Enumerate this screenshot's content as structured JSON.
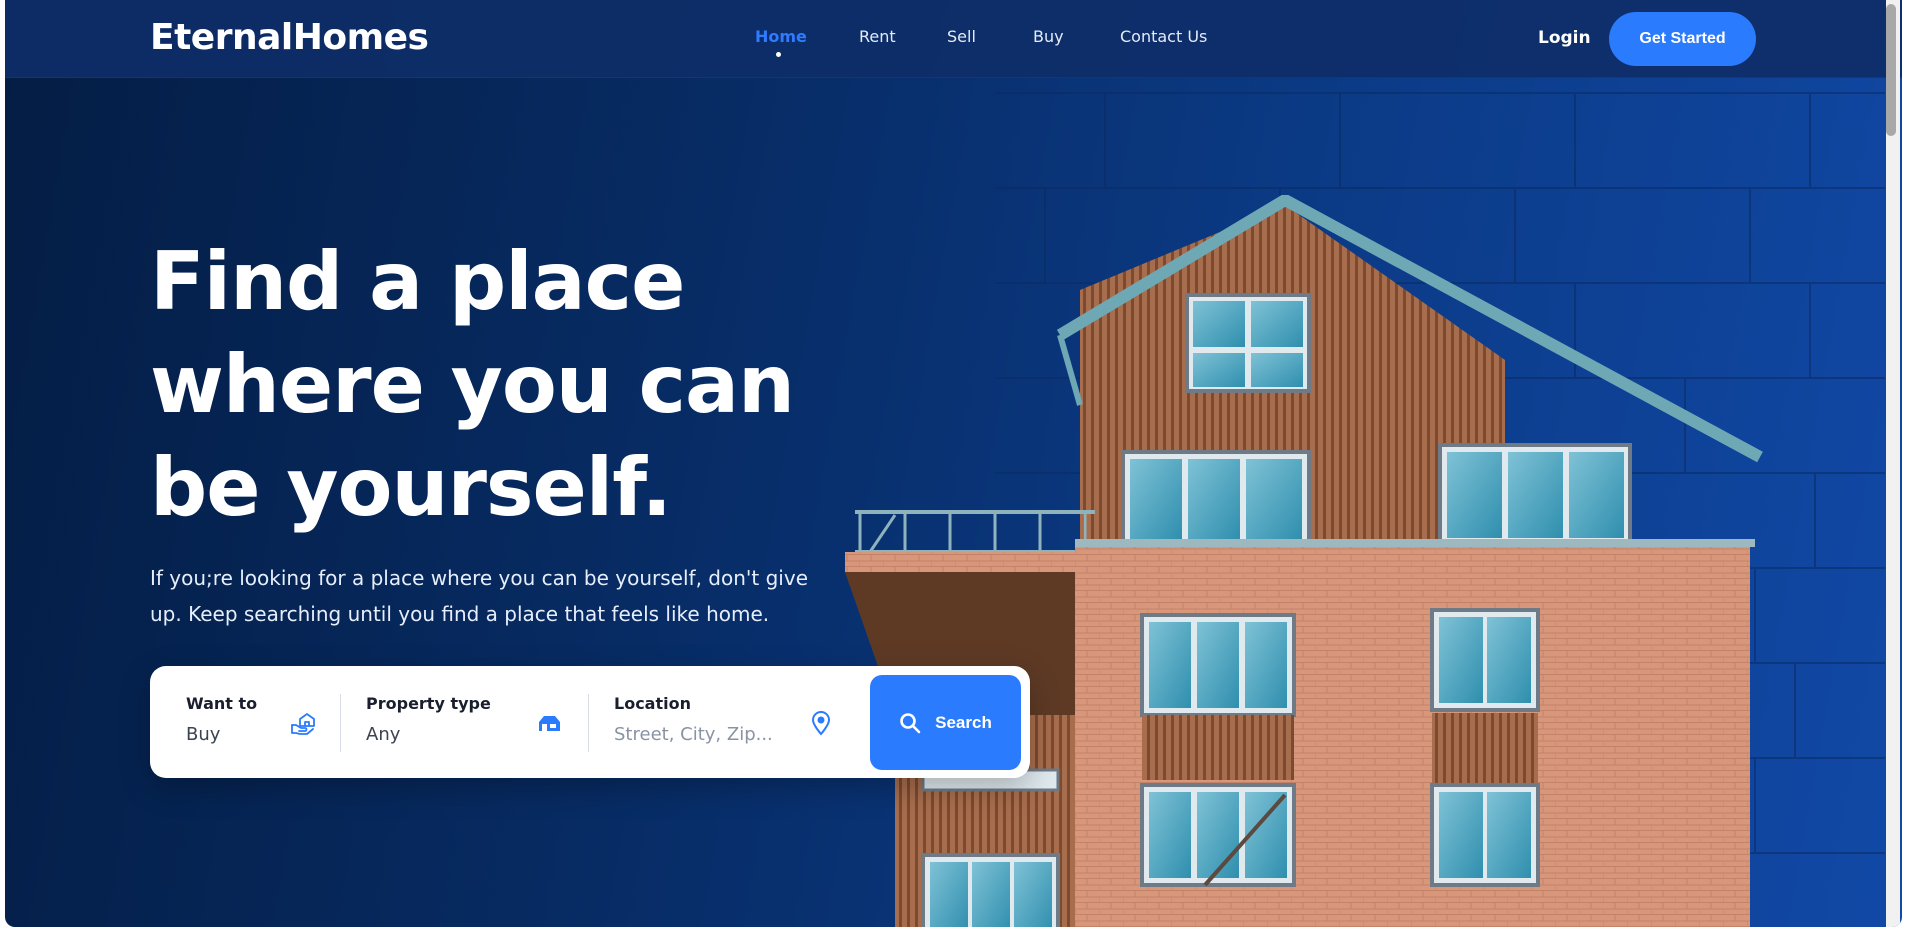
{
  "brand": {
    "name": "EternalHomes"
  },
  "nav": {
    "items": [
      {
        "label": "Home",
        "active": true
      },
      {
        "label": "Rent",
        "active": false
      },
      {
        "label": "Sell",
        "active": false
      },
      {
        "label": "Buy",
        "active": false
      },
      {
        "label": "Contact Us",
        "active": false
      }
    ],
    "login_label": "Login",
    "cta_label": "Get Started"
  },
  "hero": {
    "title_line1": "Find a place",
    "title_line2": "where you can",
    "title_line3": "be yourself.",
    "subtitle_line1": "If you;re looking for a place where you can be yourself, don't give",
    "subtitle_line2": "up. Keep searching until you find a place that feels like home."
  },
  "search": {
    "want_to": {
      "label": "Want to",
      "value": "Buy",
      "icon": "hand-house-icon"
    },
    "property_type": {
      "label": "Property type",
      "value": "Any",
      "icon": "house-icon"
    },
    "location": {
      "label": "Location",
      "placeholder": "Street, City, Zip...",
      "icon": "map-pin-icon"
    },
    "button_label": "Search",
    "button_icon": "search-icon"
  },
  "colors": {
    "accent": "#2b7bff",
    "navbar": "#0e2e68",
    "hero_dark": "#041d44",
    "hero_light": "#1149a7"
  }
}
